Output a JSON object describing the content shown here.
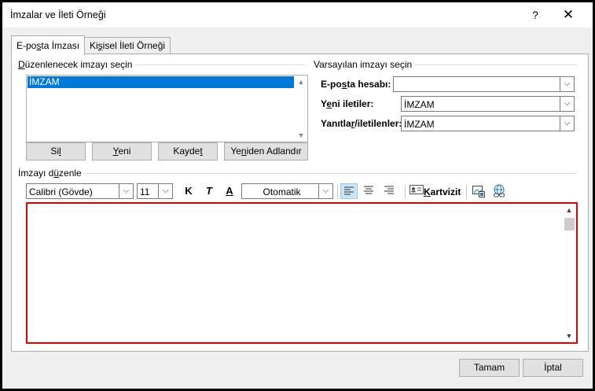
{
  "window": {
    "title": "İmzalar ve İleti Örneği",
    "help": "?",
    "close": "✕"
  },
  "tabs": [
    {
      "label_pre": "E-po",
      "label_ul": "s",
      "label_post": "ta İmzası"
    },
    {
      "label_pre": "Ki",
      "label_ul": "ş",
      "label_post": "isel İleti Örneği"
    }
  ],
  "select_group": {
    "label_pre": "",
    "label_ul": "D",
    "label_post": "üzenlenecek imzayı seçin",
    "items": [
      "İMZAM"
    ]
  },
  "list_buttons": {
    "delete": {
      "pre": "Si",
      "ul": "l",
      "post": ""
    },
    "new": {
      "pre": "",
      "ul": "Y",
      "post": "eni"
    },
    "save": {
      "pre": "Kayde",
      "ul": "t",
      "post": ""
    },
    "rename": {
      "pre": "Ye",
      "ul": "n",
      "post": "iden Adlandır"
    }
  },
  "default_group": {
    "label": "Varsayılan imzayı seçin",
    "email_account": {
      "pre": "E-po",
      "ul": "s",
      "post": "ta hesabı:",
      "value": ""
    },
    "new_messages": {
      "pre": "Y",
      "ul": "e",
      "post": "ni iletiler:",
      "value": "İMZAM"
    },
    "replies": {
      "pre": "Yanıtla",
      "ul": "r",
      "post": "/iletilenler:",
      "value": "İMZAM"
    }
  },
  "edit_group": {
    "pre": "İmzayı d",
    "ul": "ü",
    "post": "zenle"
  },
  "toolbar": {
    "font": "Calibri (Gövde)",
    "size": "11",
    "bold": "K",
    "italic": "T",
    "underline": "A",
    "color": "Otomatik",
    "business_card": {
      "pre": "",
      "ul": "K",
      "post": "artvizit"
    }
  },
  "footer": {
    "ok": "Tamam",
    "cancel": "İptal"
  },
  "colors": {
    "selection": "#0078d7",
    "highlight_border": "#e60000"
  }
}
